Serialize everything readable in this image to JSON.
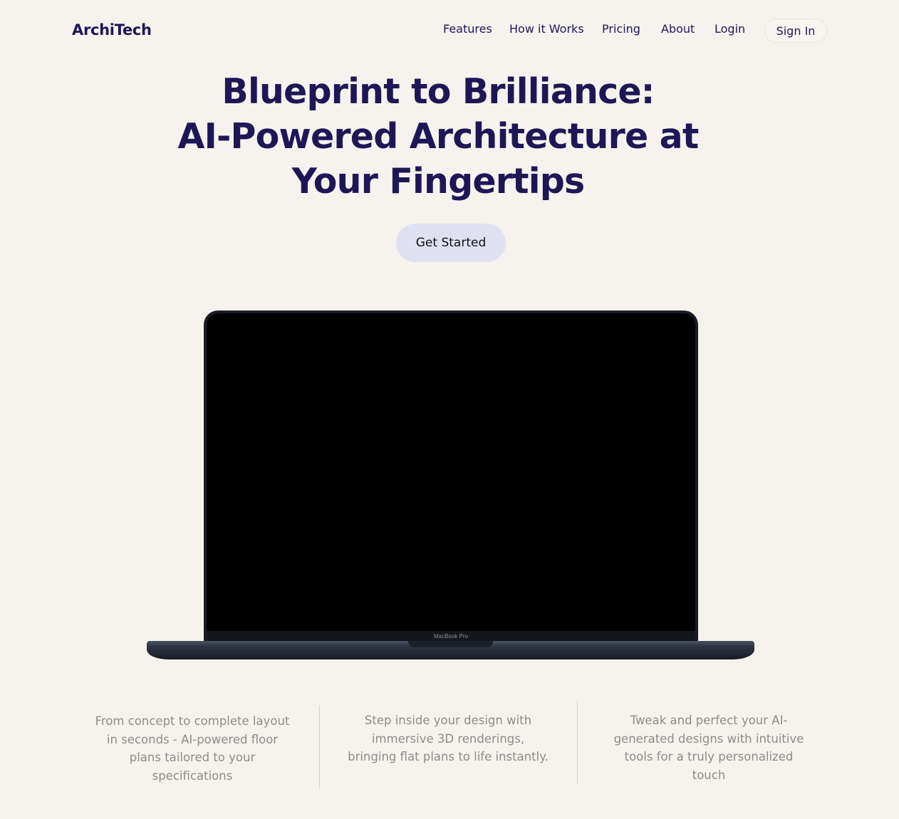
{
  "brand": {
    "name": "ArchiTech"
  },
  "nav": {
    "items": [
      "Features",
      "How it Works",
      "Pricing",
      "About",
      "Login"
    ],
    "sign_in": "Sign In"
  },
  "hero": {
    "title_lines": [
      "Blueprint to Brilliance:",
      "AI-Powered Architecture at",
      "Your Fingertips"
    ],
    "cta_label": "Get Started"
  },
  "device": {
    "label": "MacBook Pro"
  },
  "features": [
    {
      "text": "From concept to complete layout in seconds - AI-powered floor plans tailored to your specifications"
    },
    {
      "text": "Step inside your design with immersive 3D renderings, bringing flat plans to life instantly."
    },
    {
      "text": "Tweak and perfect your AI-generated designs with intuitive tools for a truly personalized touch"
    }
  ],
  "colors": {
    "background": "#f6f3ee",
    "brand": "#1e1756",
    "cta_background": "#dfe1f1",
    "muted_text": "#8e8c8a"
  }
}
